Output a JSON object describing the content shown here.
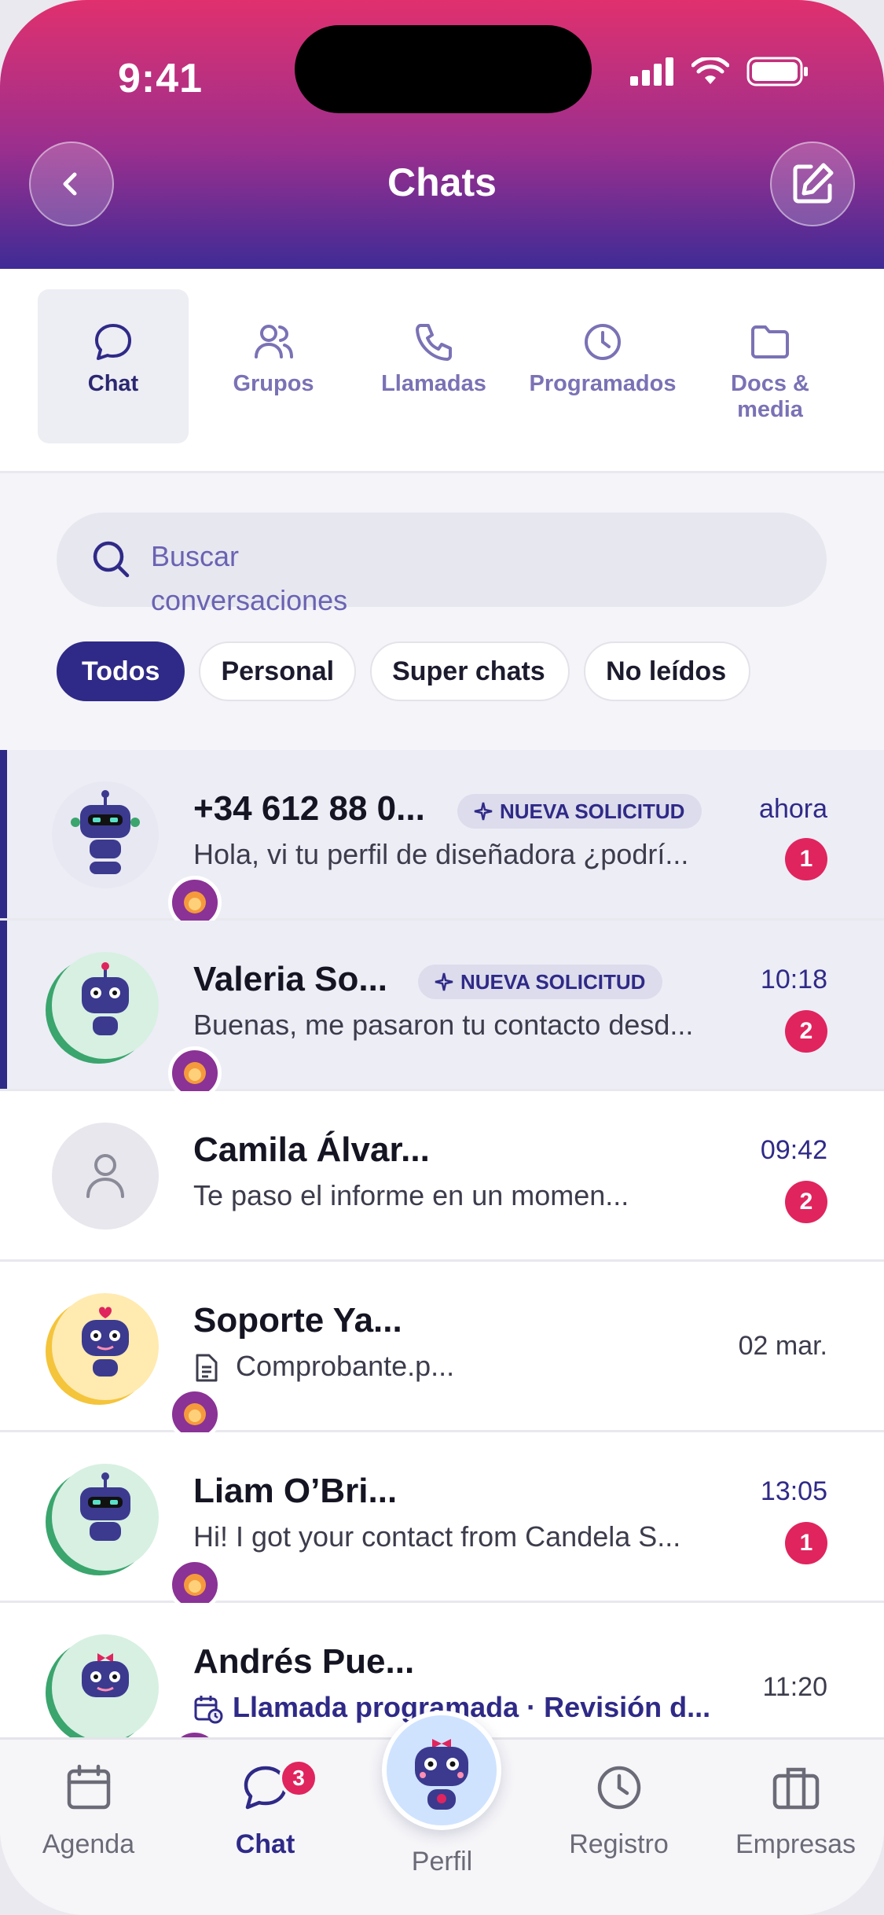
{
  "status_bar": {
    "time": "9:41"
  },
  "header": {
    "title": "Chats"
  },
  "tabs": [
    {
      "label": "Chat",
      "icon": "chat-bubble-icon",
      "active": true
    },
    {
      "label": "Grupos",
      "icon": "users-icon"
    },
    {
      "label": "Llamadas",
      "icon": "phone-icon"
    },
    {
      "label": "Programados",
      "icon": "clock-icon"
    },
    {
      "label": "Docs &\nmedia",
      "icon": "folder-icon"
    }
  ],
  "search": {
    "placeholder": "Buscar conversaciones"
  },
  "filters": [
    {
      "label": "Todos",
      "active": true
    },
    {
      "label": "Personal"
    },
    {
      "label": "Super chats"
    },
    {
      "label": "No leídos"
    }
  ],
  "chats": [
    {
      "name": "+34 612 88 0...",
      "badge": "NUEVA SOLICITUD",
      "preview": "Hola, vi tu perfil de diseñadora ¿podrí...",
      "time": "ahora",
      "unread": "1"
    },
    {
      "name": "Valeria So...",
      "badge": "NUEVA SOLICITUD",
      "preview": "Buenas, me pasaron tu contacto desd...",
      "time": "10:18",
      "unread": "2"
    },
    {
      "name": "Camila Álvar...",
      "preview": "Te paso el informe en un momen...",
      "time": "09:42",
      "unread": "2"
    },
    {
      "name": "Soporte Ya...",
      "preview": "Comprobante.p...",
      "time": "02 mar."
    },
    {
      "name": "Liam O’Bri...",
      "preview": "Hi! I got your contact from Candela S...",
      "time": "13:05",
      "unread": "1"
    },
    {
      "name": "Andrés Pue...",
      "preview": "Llamada programada · Revisión d...",
      "time": "11:20"
    }
  ],
  "bottom_nav": {
    "items": [
      {
        "label": "Agenda",
        "icon": "calendar-icon"
      },
      {
        "label": "Chat",
        "icon": "chat-bubble-icon",
        "badge": "3",
        "active": true
      },
      {
        "label": "Perfil",
        "icon": "robot-avatar-icon"
      },
      {
        "label": "Registro",
        "icon": "clock-icon"
      },
      {
        "label": "Empresas",
        "icon": "briefcase-icon"
      }
    ]
  },
  "colors": {
    "primary": "#2f2a87",
    "accent": "#e0245e",
    "header_top": "#e0306e",
    "header_bottom": "#3f2b96"
  }
}
